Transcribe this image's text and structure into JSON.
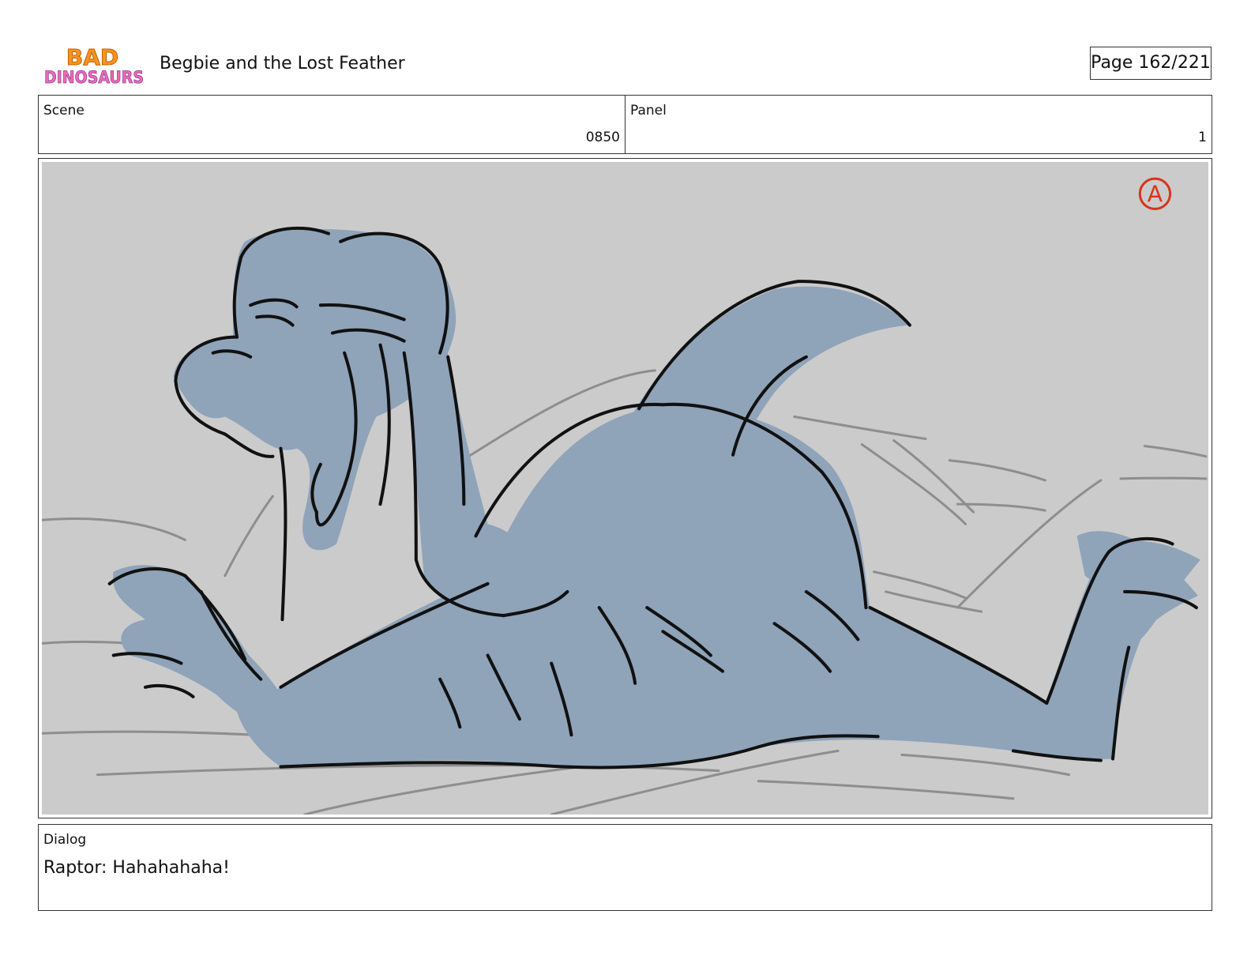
{
  "header": {
    "logo_text_line1": "BAD",
    "logo_text_line2": "DINOSAURS",
    "title": "Begbie and the Lost Feather",
    "page_label": "Page 162/221"
  },
  "info": {
    "scene_label": "Scene",
    "scene_value": "0850",
    "panel_label": "Panel",
    "panel_value": "1"
  },
  "panel": {
    "corner_mark": "A",
    "colors": {
      "background": "#cbcbcb",
      "character_fill": "#8fa3b9",
      "ink": "#111111",
      "sketch_lines": "#8e8e8e",
      "corner_mark": "#d8341c"
    }
  },
  "dialog": {
    "label": "Dialog",
    "text": "Raptor: Hahahahaha!"
  }
}
